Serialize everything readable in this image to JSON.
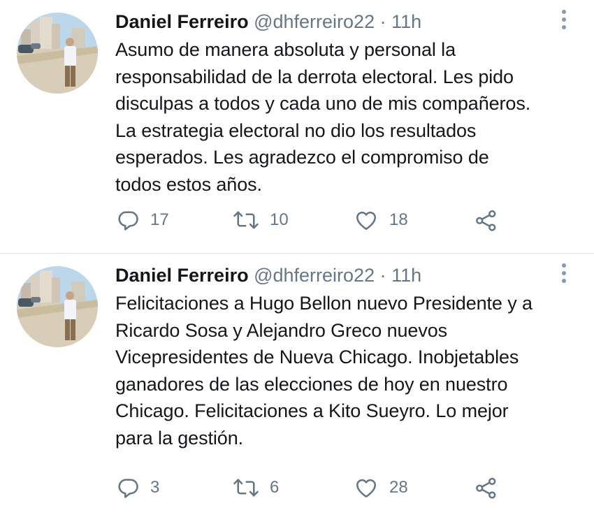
{
  "tweets": [
    {
      "author_name": "Daniel Ferreiro",
      "handle": "@dhferreiro22",
      "separator": "·",
      "time": "11h",
      "text_lines": [
        "Asumo de manera absoluta y personal la",
        "responsabilidad de la derrota electoral. Les pido",
        "disculpas a todos y cada uno de mis compañeros.",
        "La estrategia electoral no dio los resultados",
        "esperados. Les agradezco el compromiso de",
        "todos estos años."
      ],
      "replies": "17",
      "retweets": "10",
      "likes": "18"
    },
    {
      "author_name": "Daniel Ferreiro",
      "handle": "@dhferreiro22",
      "separator": "·",
      "time": "11h",
      "text_lines": [
        "Felicitaciones a Hugo Bellon nuevo Presidente y a",
        "Ricardo Sosa y Alejandro Greco nuevos",
        "Vicepresidentes de Nueva Chicago. Inobjetables",
        "ganadores de las elecciones de hoy en nuestro",
        "Chicago. Felicitaciones a Kito Sueyro. Lo mejor",
        "para la gestión."
      ],
      "replies": "3",
      "retweets": "6",
      "likes": "28"
    }
  ],
  "colors": {
    "text": "#14171a",
    "secondary": "#657786",
    "icon": "#657786",
    "divider": "#dfe3e7"
  },
  "icons": {
    "reply": "reply-icon",
    "retweet": "retweet-icon",
    "like": "heart-icon",
    "share": "share-icon",
    "more": "more-vertical-icon"
  }
}
